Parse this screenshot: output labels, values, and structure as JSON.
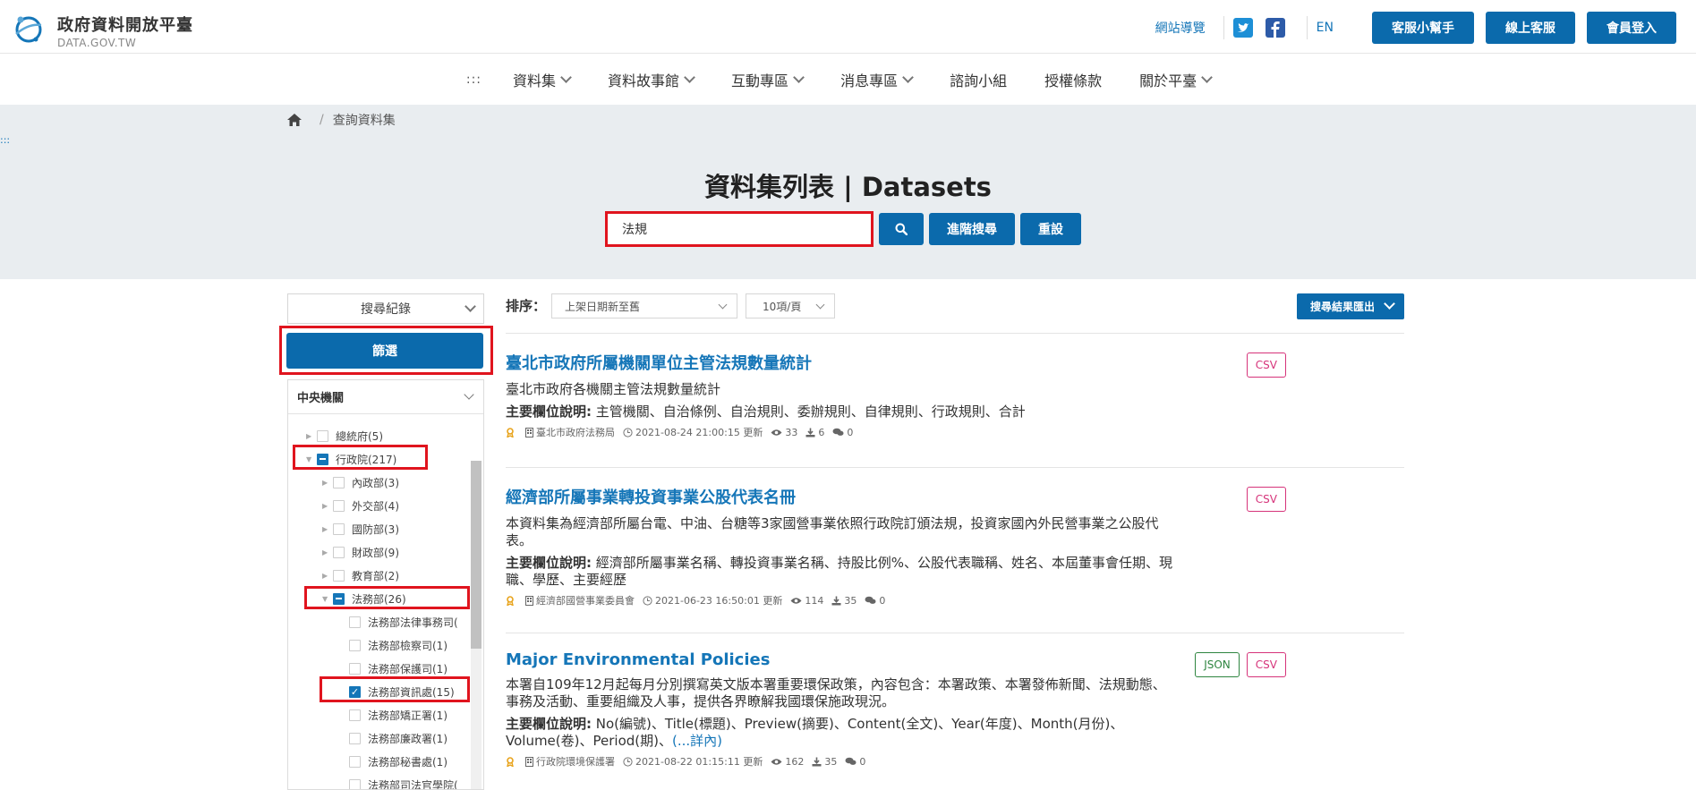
{
  "header": {
    "site_title": "政府資料開放平臺",
    "site_domain": "DATA.GOV.TW",
    "sitemap": "網站導覽",
    "lang": "EN",
    "buttons": [
      "客服小幫手",
      "線上客服",
      "會員登入"
    ],
    "brand_color": "#0b6aac"
  },
  "nav": {
    "accesskey": ":::",
    "items": [
      "資料集",
      "資料故事館",
      "互動專區",
      "消息專區",
      "諮詢小組",
      "授權條款",
      "關於平臺"
    ]
  },
  "hero": {
    "left_accesskey": ":::",
    "breadcrumb": "查詢資料集",
    "title": "資料集列表 | Datasets",
    "search_value": "法規",
    "advanced_search": "進階搜尋",
    "reset": "重設"
  },
  "sidebar": {
    "history": "搜尋紀錄",
    "filter": "篩選",
    "panel_title": "中央機關",
    "tree": [
      {
        "label": "總統府(5)",
        "state": "none"
      },
      {
        "label": "行政院(217)",
        "state": "partial"
      },
      {
        "label": "內政部(3)",
        "state": "none"
      },
      {
        "label": "外交部(4)",
        "state": "none"
      },
      {
        "label": "國防部(3)",
        "state": "none"
      },
      {
        "label": "財政部(9)",
        "state": "none"
      },
      {
        "label": "教育部(2)",
        "state": "none"
      },
      {
        "label": "法務部(26)",
        "state": "partial"
      },
      {
        "label": "法務部法律事務司(",
        "state": "none"
      },
      {
        "label": "法務部檢察司(1)",
        "state": "none"
      },
      {
        "label": "法務部保護司(1)",
        "state": "none"
      },
      {
        "label": "法務部資訊處(15)",
        "state": "checked"
      },
      {
        "label": "法務部矯正署(1)",
        "state": "none"
      },
      {
        "label": "法務部廉政署(1)",
        "state": "none"
      },
      {
        "label": "法務部秘書處(1)",
        "state": "none"
      },
      {
        "label": "法務部司法官學院(",
        "state": "none"
      }
    ]
  },
  "results": {
    "sort_label": "排序：",
    "sort_value": "上架日期新至舊",
    "page_size": "10項/頁",
    "export": "搜尋結果匯出",
    "items": [
      {
        "title": "臺北市政府所屬機關單位主管法規數量統計",
        "desc": "臺北市政府各機關主管法規數量統計",
        "fields_label": "主要欄位說明:",
        "fields": " 主管機關、自治條例、自治規則、委辦規則、自律規則、行政規則、合計",
        "more": "",
        "agency": "臺北市政府法務局",
        "updated": "2021-08-24 21:00:15 更新",
        "views": "33",
        "downloads": "6",
        "comments": "0",
        "formats": [
          "CSV"
        ]
      },
      {
        "title": "經濟部所屬事業轉投資事業公股代表名冊",
        "desc": "本資料集為經濟部所屬台電、中油、台糖等3家國營事業依照行政院訂頒法規，投資家國內外民營事業之公股代表。",
        "fields_label": "主要欄位說明:",
        "fields": " 經濟部所屬事業名稱、轉投資事業名稱、持股比例%、公股代表職稱、姓名、本屆董事會任期、現職、學歷、主要經歷",
        "more": "",
        "agency": "經濟部國營事業委員會",
        "updated": "2021-06-23 16:50:01 更新",
        "views": "114",
        "downloads": "35",
        "comments": "0",
        "formats": [
          "CSV"
        ]
      },
      {
        "title": "Major Environmental Policies",
        "desc": "本署自109年12月起每月分別撰寫英文版本署重要環保政策，內容包含：本署政策、本署發佈新聞、法規動態、事務及活動、重要組織及人事，提供各界瞭解我國環保施政現況。",
        "fields_label": "主要欄位說明:",
        "fields": " No(編號)、Title(標題)、Preview(摘要)、Content(全文)、Year(年度)、Month(月份)、Volume(卷)、Period(期)、",
        "more": "(...詳內)",
        "agency": "行政院環境保護署",
        "updated": "2021-08-22 01:15:11 更新",
        "views": "162",
        "downloads": "35",
        "comments": "0",
        "formats": [
          "JSON",
          "CSV"
        ]
      }
    ]
  }
}
